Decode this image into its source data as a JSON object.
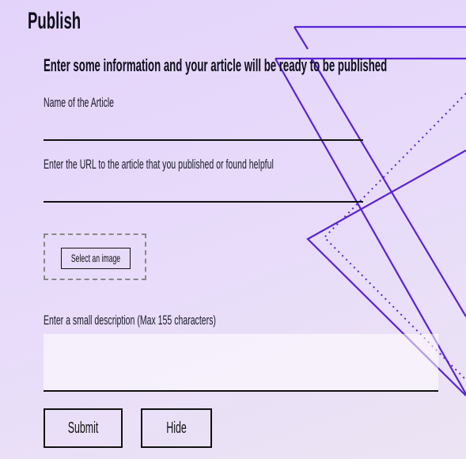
{
  "page": {
    "title": "Publish"
  },
  "form": {
    "heading": "Enter some information and your article will be ready to be published",
    "name_label": "Name of the Article",
    "name_value": "",
    "url_label": "Enter the URL to the article that you published or found helpful",
    "url_value": "",
    "select_image_label": "Select an image",
    "description_label": "Enter a small description (Max 155 characters)",
    "description_value": "",
    "submit_label": "Submit",
    "hide_label": "Hide"
  },
  "colors": {
    "background": "#e6d8fb",
    "accent_lines": "#5a22d6",
    "text": "#111111"
  }
}
